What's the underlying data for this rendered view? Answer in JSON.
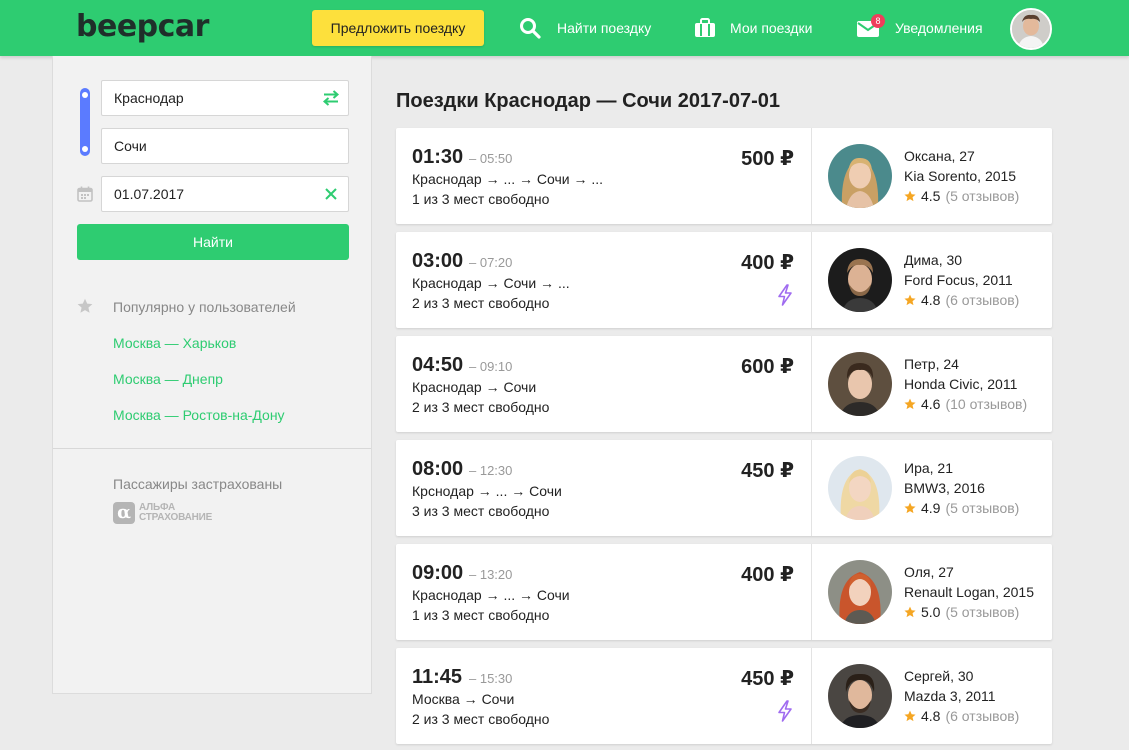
{
  "header": {
    "logo": "beepcar",
    "offer_button": "Предложить поездку",
    "nav": {
      "find": "Найти поездку",
      "my_trips": "Мои поездки",
      "notifications": "Уведомления",
      "notifications_count": "8"
    }
  },
  "search": {
    "from": "Краснодар",
    "to": "Сочи",
    "date": "01.07.2017",
    "submit": "Найти"
  },
  "popular": {
    "title": "Популярно у пользователей",
    "links": [
      "Москва — Харьков",
      "Москва — Днепр",
      "Москва — Ростов-на-Дону"
    ]
  },
  "insurance": {
    "label": "Пассажиры застрахованы",
    "logo_line1": "АЛЬФА",
    "logo_line2": "СТРАХОВАНИЕ"
  },
  "page_title": "Поездки Краснодар — Сочи 2017-07-01",
  "trips": [
    {
      "dep": "01:30",
      "arr": "– 05:50",
      "route": "Краснодар → ... → Сочи → ...",
      "seats": "1 из 3 мест свободно",
      "price": "500 ₽",
      "instant": false,
      "driver": {
        "name": "Оксана, 27",
        "car": "Kia Sorento, 2015",
        "rating": "4.5",
        "reviews": "(5 отзывов)"
      }
    },
    {
      "dep": "03:00",
      "arr": "– 07:20",
      "route": "Краснодар → Сочи → ...",
      "seats": "2 из 3 мест свободно",
      "price": "400 ₽",
      "instant": true,
      "driver": {
        "name": "Дима, 30",
        "car": "Ford Focus, 2011",
        "rating": "4.8",
        "reviews": "(6 отзывов)"
      }
    },
    {
      "dep": "04:50",
      "arr": "– 09:10",
      "route": "Краснодар → Сочи",
      "seats": "2 из 3 мест свободно",
      "price": "600 ₽",
      "instant": false,
      "driver": {
        "name": "Петр, 24",
        "car": "Honda Civic, 2011",
        "rating": "4.6",
        "reviews": "(10 отзывов)"
      }
    },
    {
      "dep": "08:00",
      "arr": "– 12:30",
      "route": "Крснодар → ... → Сочи",
      "seats": "3 из 3 мест свободно",
      "price": "450 ₽",
      "instant": false,
      "driver": {
        "name": "Ира, 21",
        "car": "BMW3, 2016",
        "rating": "4.9",
        "reviews": "(5 отзывов)"
      }
    },
    {
      "dep": "09:00",
      "arr": "– 13:20",
      "route": "Краснодар → ... → Сочи",
      "seats": "1 из 3 мест свободно",
      "price": "400 ₽",
      "instant": false,
      "driver": {
        "name": "Оля, 27",
        "car": "Renault Logan, 2015",
        "rating": "5.0",
        "reviews": "(5 отзывов)"
      }
    },
    {
      "dep": "11:45",
      "arr": "– 15:30",
      "route": "Москва → Сочи",
      "seats": "2 из 3 мест свободно",
      "price": "450 ₽",
      "instant": true,
      "driver": {
        "name": "Сергей, 30",
        "car": "Mazda 3, 2011",
        "rating": "4.8",
        "reviews": "(6 отзывов)"
      }
    }
  ],
  "colors": {
    "brand_green": "#2ecc71",
    "accent_yellow": "#fde03c",
    "route_blue": "#5b7bff",
    "badge_red": "#ef3d5b",
    "instant_purple": "#a06cf0",
    "star_gold": "#f5a623"
  }
}
